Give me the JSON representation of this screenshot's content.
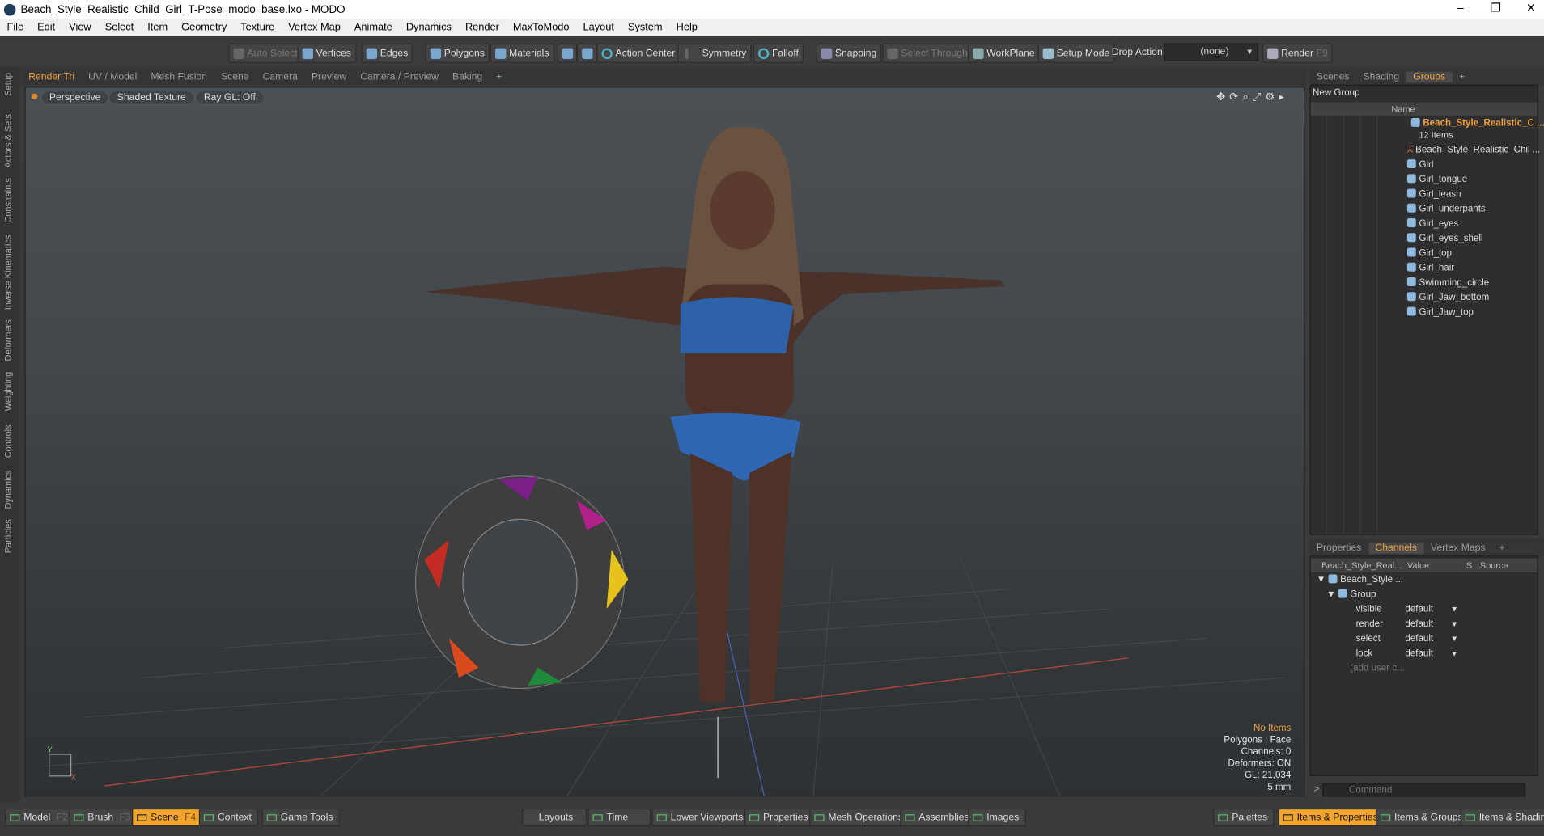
{
  "window": {
    "title": "Beach_Style_Realistic_Child_Girl_T-Pose_modo_base.lxo - MODO",
    "minimize": "–",
    "restore": "❐",
    "close": "✕"
  },
  "menu": [
    "File",
    "Edit",
    "View",
    "Select",
    "Item",
    "Geometry",
    "Texture",
    "Vertex Map",
    "Animate",
    "Dynamics",
    "Render",
    "MaxToModo",
    "Layout",
    "System",
    "Help"
  ],
  "toolbar": {
    "auto_select": "Auto Select",
    "vertices": "Vertices",
    "edges": "Edges",
    "polygons": "Polygons",
    "materials": "Materials",
    "action_center": "Action Center",
    "symmetry": "Symmetry",
    "falloff": "Falloff",
    "snapping": "Snapping",
    "select_through": "Select Through",
    "workplane": "WorkPlane",
    "setup_mode": "Setup Mode",
    "drop_action": "Drop Action",
    "drop_action_value": "(none)",
    "render": "Render",
    "render_key": "F9"
  },
  "left_tabs": [
    "Setup",
    "Actors & Sets",
    "Constraints",
    "Inverse Kinematics",
    "Deformers",
    "Weighting",
    "Controls",
    "Dynamics",
    "Particles"
  ],
  "viewport_tabs": [
    "Render Tri",
    "UV / Model",
    "Mesh Fusion",
    "Scene",
    "Camera",
    "Preview",
    "Camera / Preview",
    "Baking",
    "+"
  ],
  "viewport": {
    "view_mode": "Perspective",
    "shading": "Shaded Texture",
    "raygl": "Ray GL: Off",
    "axis_y": "Y",
    "axis_x": "X"
  },
  "hud": {
    "items": "No Items",
    "polygons": "Polygons : Face",
    "channels": "Channels: 0",
    "deformers": "Deformers: ON",
    "gl": "GL: 21,034",
    "size": "5 mm"
  },
  "right_tabs": [
    "Scenes",
    "Shading",
    "Groups",
    "+"
  ],
  "groups": {
    "new_group": "New Group",
    "name_col": "Name",
    "root": "Beach_Style_Realistic_C ...",
    "count": "12 Items",
    "items": [
      "Beach_Style_Realistic_Chil ...",
      "Girl",
      "Girl_tongue",
      "Girl_leash",
      "Girl_underpants",
      "Girl_eyes",
      "Girl_eyes_shell",
      "Girl_top",
      "Girl_hair",
      "Swimming_circle",
      "Girl_Jaw_bottom",
      "Girl_Jaw_top"
    ]
  },
  "props_tabs": [
    "Properties",
    "Channels",
    "Vertex Maps",
    "+"
  ],
  "channels": {
    "col_name": "Beach_Style_Real...",
    "col_value": "Value",
    "col_s": "S",
    "col_source": "Source",
    "item": "Beach_Style ...",
    "group": "Group",
    "rows": [
      {
        "name": "visible",
        "value": "default"
      },
      {
        "name": "render",
        "value": "default"
      },
      {
        "name": "select",
        "value": "default"
      },
      {
        "name": "lock",
        "value": "default"
      }
    ],
    "add": "(add user c..."
  },
  "command": {
    "prompt": ">",
    "placeholder": "Command"
  },
  "bottom": {
    "model": "Model",
    "model_key": "F2",
    "brush": "Brush",
    "brush_key": "F3",
    "scene": "Scene",
    "scene_key": "F4",
    "context": "Context",
    "game_tools": "Game Tools",
    "layouts": "Layouts",
    "time": "Time",
    "lower_viewports": "Lower Viewports",
    "properties": "Properties",
    "mesh_operations": "Mesh Operations",
    "assemblies": "Assemblies",
    "images": "Images",
    "palettes": "Palettes",
    "items_properties": "Items & Properties",
    "items_groups": "Items & Groups",
    "items_shading": "Items & Shading"
  },
  "colors": {
    "accent": "#f2a42c",
    "tab_active": "#f0a03c",
    "root_item": "#f0a03c"
  }
}
